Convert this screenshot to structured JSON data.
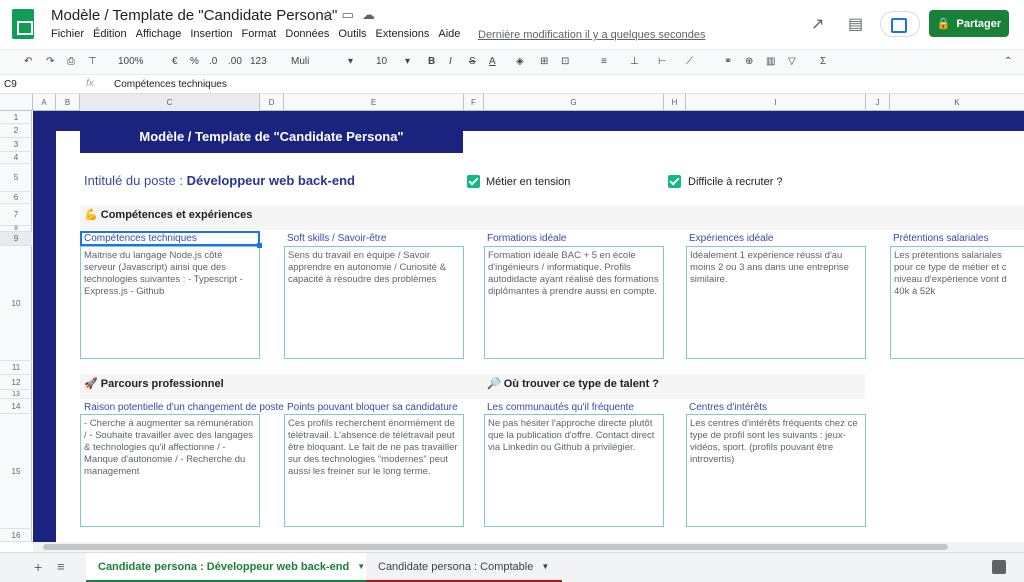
{
  "app": {
    "doc_title": "Modèle / Template de \"Candidate Persona\"",
    "last_modified": "Dernière modification il y a quelques secondes",
    "share_label": "Partager",
    "menu": [
      "Fichier",
      "Édition",
      "Affichage",
      "Insertion",
      "Format",
      "Données",
      "Outils",
      "Extensions",
      "Aide"
    ]
  },
  "toolbar": {
    "zoom": "100%",
    "currency": "€",
    "percent": "%",
    "dec_less": ".0",
    "dec_more": ".00",
    "format_more": "123",
    "font": "Muli",
    "font_size": "10"
  },
  "formula": {
    "cell_ref": "C9",
    "fx": "fx",
    "content": "Compétences techniques"
  },
  "columns": [
    "A",
    "B",
    "C",
    "D",
    "E",
    "F",
    "G",
    "H",
    "I",
    "J",
    "K"
  ],
  "rows": [
    "1",
    "2",
    "3",
    "4",
    "5",
    "6",
    "7",
    "8",
    "9",
    "10",
    "11",
    "12",
    "13",
    "14",
    "15",
    "16"
  ],
  "sheet": {
    "banner": "Modèle / Template de \"Candidate Persona\"",
    "post_label": "Intitulé du poste : ",
    "post_value": "Développeur web back-end",
    "check1": "Métier en tension",
    "check2": "Difficile à recruter ?",
    "section1": "💪 Compétences et expériences",
    "section2": "🚀 Parcours professionnel",
    "section3": "🔎 Où trouver ce type de talent ?",
    "cards1": [
      {
        "label": "Compétences techniques",
        "text": "Maitrise du langage Node.js côté serveur (Javascript) ainsi que des technologies suivantes : - Typescript - Express.js - Github"
      },
      {
        "label": "Soft skills / Savoir-être",
        "text": "Sens du travail en équipe / Savoir apprendre en autonomie / Curiosité & capacité à résoudre des problèmes"
      },
      {
        "label": "Formations idéale",
        "text": "Formation idéale BAC + 5 en école d'ingénieurs / informatique. Profils autodidacte ayant réalisé des formations diplômantes à prendre aussi en compte."
      },
      {
        "label": "Expériences idéale",
        "text": "Idéalement 1 expérience réussi d'au moins 2 ou 3 ans dans une entreprise similaire."
      },
      {
        "label": "Prétentions salariales",
        "text": "Les prétentions salariales pour ce type de métier et c niveau d'expérience vont d 40k à 52k"
      }
    ],
    "cards2": [
      {
        "label": "Raison potentielle d'un changement de poste",
        "text": " - Cherche à augmenter sa rémunération / - Souhaite travailler avec des langages & technologies qu'il affectionne / - Manque d'autonomie / - Recherche du management"
      },
      {
        "label": "Points pouvant bloquer sa candidature",
        "text": "Ces profils recherchent énormément de télétravail. L'absence de télétravail peut être bloquant. Le fait de ne pas travailler sur des technologies \"modernes\" peut aussi les freiner sur le long terme."
      },
      {
        "label": "Les communautés qu'il fréquente",
        "text": "Ne pas hésiter l'approche directe plutôt que la publication d'offre. Contact direct via Linkedin ou Github à privilégier."
      },
      {
        "label": "Centres d'intérêts",
        "text": "Les centres d'intérêts fréquents chez ce type de profil sont les suivants : jeux-vidéos, sport. (profils pouvant être introvertis)"
      }
    ]
  },
  "tabs": {
    "active": "Candidate persona : Développeur web back-end",
    "inactive": "Candidate persona : Comptable"
  }
}
